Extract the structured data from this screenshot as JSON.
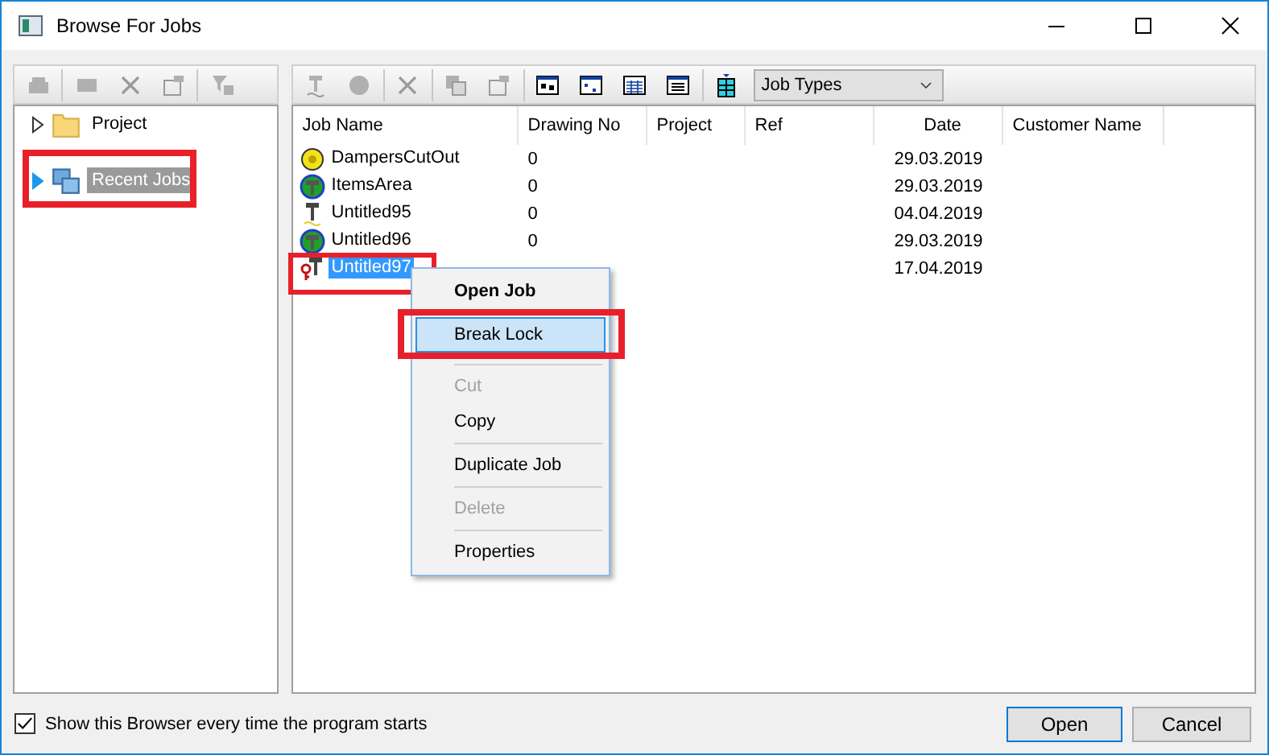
{
  "window": {
    "title": "Browse For Jobs"
  },
  "tree": [
    {
      "label": "Project",
      "kind": "folder",
      "expanded": false,
      "selected": false
    },
    {
      "label": "Recent Jobs",
      "kind": "recent",
      "expanded": false,
      "selected": true
    }
  ],
  "job_types": {
    "value": "Job Types"
  },
  "table": {
    "columns": [
      "Job Name",
      "Drawing No",
      "Project",
      "Ref",
      "Date",
      "Customer Name"
    ],
    "rows": [
      {
        "kind": "coin",
        "name": "DampersCutOut",
        "drawing_no": "0",
        "date": "29.03.2019",
        "selected": false
      },
      {
        "kind": "globe",
        "name": "ItemsArea",
        "drawing_no": "0",
        "date": "29.03.2019",
        "selected": false
      },
      {
        "kind": "tool",
        "name": "Untitled95",
        "drawing_no": "0",
        "date": "04.04.2019",
        "selected": false
      },
      {
        "kind": "globe",
        "name": "Untitled96",
        "drawing_no": "0",
        "date": "29.03.2019",
        "selected": false
      },
      {
        "kind": "locked",
        "name": "Untitled97",
        "date": "17.04.2019",
        "selected": true
      }
    ]
  },
  "context_menu": [
    {
      "label": "Open Job",
      "kind": "default",
      "disabled": false,
      "selected": false
    },
    {
      "label": "Break Lock",
      "kind": "item",
      "disabled": false,
      "selected": true
    },
    {
      "kind": "separator"
    },
    {
      "label": "Cut",
      "kind": "item",
      "disabled": true,
      "selected": false
    },
    {
      "label": "Copy",
      "kind": "item",
      "disabled": false,
      "selected": false
    },
    {
      "kind": "separator"
    },
    {
      "label": "Duplicate Job",
      "kind": "item",
      "disabled": false,
      "selected": false
    },
    {
      "kind": "separator"
    },
    {
      "label": "Delete",
      "kind": "item",
      "disabled": true,
      "selected": false
    },
    {
      "kind": "separator"
    },
    {
      "label": "Properties",
      "kind": "item",
      "disabled": false,
      "selected": false
    }
  ],
  "show_browser": {
    "label": "Show this Browser every time the program starts",
    "checked": true
  },
  "buttons": [
    {
      "label": "Open",
      "default": true
    },
    {
      "label": "Cancel",
      "default": false
    }
  ]
}
